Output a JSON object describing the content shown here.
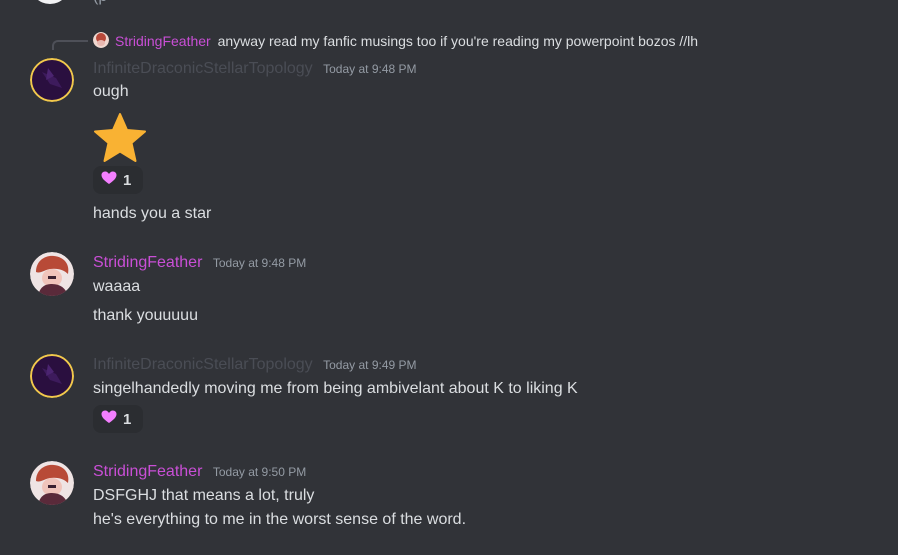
{
  "colors": {
    "background": "#313338",
    "text": "#dbdee1",
    "muted": "#949ba4",
    "strider": "#c94fd6",
    "infinite": "#4a4d55",
    "star": "#f9b233",
    "heart": "#f47fff"
  },
  "top_partial": {
    "text": "(p"
  },
  "reply": {
    "author": "StridingFeather",
    "text": "anyway read my fanfic musings too if you're reading my powerpoint bozos //lh"
  },
  "messages": [
    {
      "author": "InfiniteDraconicStellarTopology",
      "timestamp": "Today at 9:48 PM",
      "lines": [
        "ough"
      ],
      "emoji": "star-emoji",
      "reaction": {
        "emoji": "heart-icon",
        "count": "1"
      },
      "extra_line": "hands you a star"
    },
    {
      "author": "StridingFeather",
      "timestamp": "Today at 9:48 PM",
      "lines": [
        "waaaa",
        "thank youuuuu"
      ]
    },
    {
      "author": "InfiniteDraconicStellarTopology",
      "timestamp": "Today at 9:49 PM",
      "lines": [
        "singelhandedly moving me from being ambivelant about K to liking K"
      ],
      "reaction": {
        "emoji": "heart-icon",
        "count": "1"
      }
    },
    {
      "author": "StridingFeather",
      "timestamp": "Today at 9:50 PM",
      "lines": [
        "DSFGHJ that means a lot, truly",
        "he's everything to me in the worst sense of the word."
      ]
    }
  ]
}
